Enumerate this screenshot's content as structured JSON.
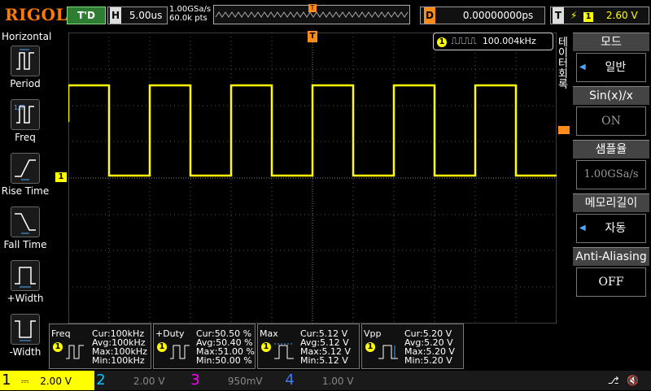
{
  "topbar": {
    "brand": "RIGOL",
    "run_status": "T'D",
    "timebase_label": "H",
    "timebase_value": "5.00us",
    "sample_rate": "1.00GSa/s",
    "sample_points": "60.0k pts",
    "delay_label": "D",
    "delay_value": "0.00000000ps",
    "trigger_label": "T",
    "trigger_source": "1",
    "trigger_level": "2.60 V"
  },
  "left_menu": {
    "title": "Horizontal",
    "items": [
      {
        "label": "Period",
        "icon": "period-icon"
      },
      {
        "label": "Freq",
        "icon": "freq-icon"
      },
      {
        "label": "Rise Time",
        "icon": "rise-time-icon"
      },
      {
        "label": "Fall Time",
        "icon": "fall-time-icon"
      },
      {
        "label": "+Width",
        "icon": "pos-width-icon"
      },
      {
        "label": "-Width",
        "icon": "neg-width-icon"
      }
    ]
  },
  "freq_counter": {
    "channel": "1",
    "value": "100.004kHz"
  },
  "side_tag": "테이터회록",
  "right_menu": [
    {
      "title": "모드",
      "value": "일반",
      "arrow": true,
      "dim": false
    },
    {
      "title": "Sin(x)/x",
      "value": "ON",
      "arrow": false,
      "dim": true
    },
    {
      "title": "샘플율",
      "value": "1.00GSa/s",
      "arrow": false,
      "dim": true
    },
    {
      "title": "메모리길이",
      "value": "자동",
      "arrow": true,
      "dim": false
    },
    {
      "title": "Anti-Aliasing",
      "value": "OFF",
      "arrow": false,
      "dim": false
    }
  ],
  "measurements": [
    {
      "name": "Freq",
      "cur": "Cur:100kHz",
      "avg": "Avg:100kHz",
      "max": "Max:100kHz",
      "min": "Min:100kHz"
    },
    {
      "name": "+Duty",
      "cur": "Cur:50.50 %",
      "avg": "Avg:50.40 %",
      "max": "Max:51.00 %",
      "min": "Min:50.00 %"
    },
    {
      "name": "Max",
      "cur": "Cur:5.12 V",
      "avg": "Avg:5.12 V",
      "max": "Max:5.12 V",
      "min": "Min:5.12 V"
    },
    {
      "name": "Vpp",
      "cur": "Cur:5.20 V",
      "avg": "Avg:5.20 V",
      "max": "Max:5.20 V",
      "min": "Min:5.20 V"
    }
  ],
  "channels": [
    {
      "num": "1",
      "scale": "2.00 V",
      "color": "#ffff00",
      "active": true
    },
    {
      "num": "2",
      "scale": "2.00 V",
      "color": "#00c8ff",
      "active": false
    },
    {
      "num": "3",
      "scale": "950mV",
      "color": "#ff00ff",
      "active": false
    },
    {
      "num": "4",
      "scale": "1.00 V",
      "color": "#3c78ff",
      "active": false
    }
  ],
  "markers": {
    "ch1_ground": "1",
    "trigger_pos": "T"
  },
  "colors": {
    "ch1": "#ffff00",
    "accent_orange": "#ff8c1a",
    "grid": "#555555"
  }
}
